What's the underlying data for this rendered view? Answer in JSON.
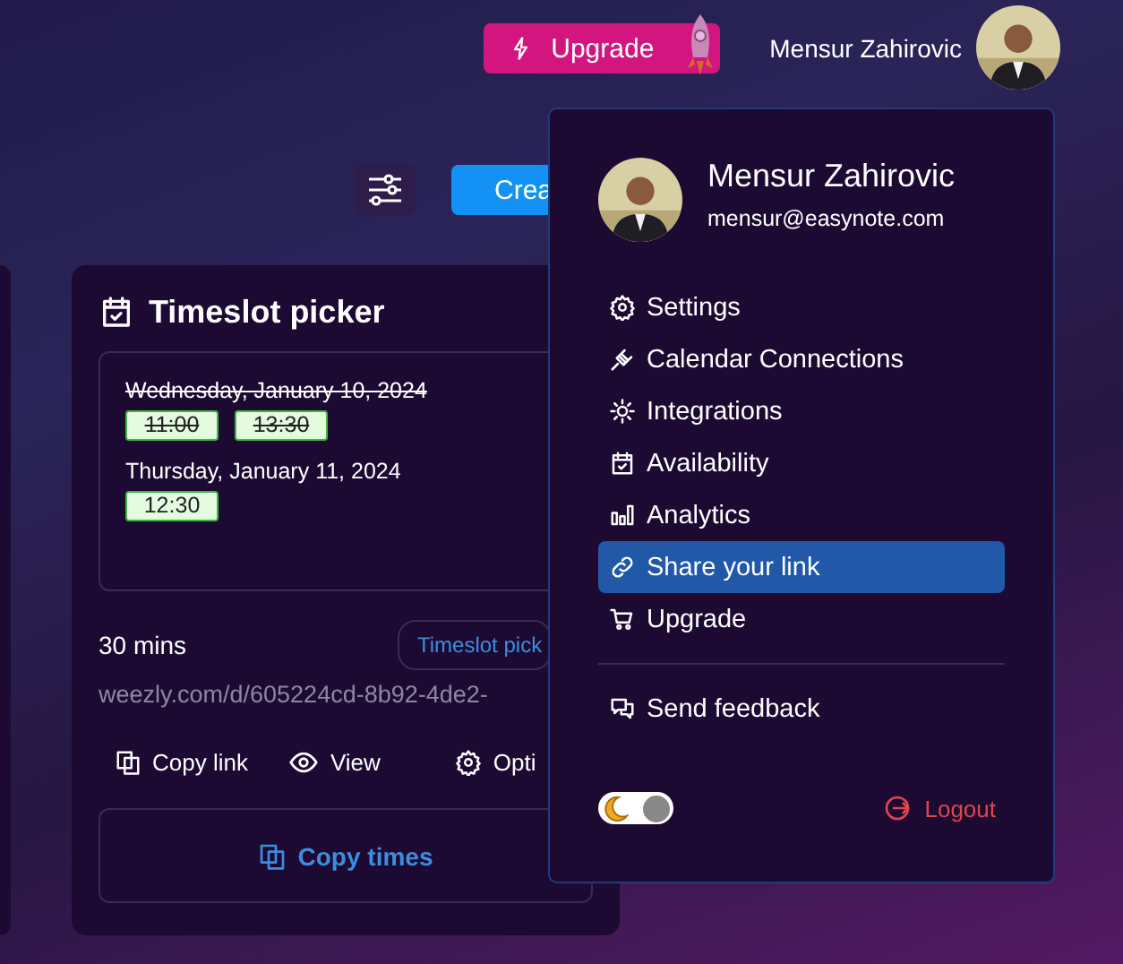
{
  "header": {
    "upgrade_button": "Upgrade",
    "user_name": "Mensur Zahirovic"
  },
  "toolbar": {
    "create_button": "Crea"
  },
  "card": {
    "title": "Timeslot picker",
    "days": [
      {
        "date": "Wednesday, January 10, 2024",
        "disabled": true,
        "slots": [
          {
            "time": "11:00",
            "disabled": true
          },
          {
            "time": "13:30",
            "disabled": true
          }
        ]
      },
      {
        "date": "Thursday, January 11, 2024",
        "disabled": false,
        "slots": [
          {
            "time": "12:30",
            "disabled": false
          }
        ]
      }
    ],
    "duration": "30 mins",
    "type_badge": "Timeslot pick",
    "link": "weezly.com/d/605224cd-8b92-4de2-",
    "actions": [
      "Copy link",
      "View",
      "Opti"
    ],
    "copy_times_button": "Copy times"
  },
  "user_menu": {
    "name": "Mensur Zahirovic",
    "email": "mensur@easynote.com",
    "items": [
      {
        "label": "Settings",
        "selected": false
      },
      {
        "label": "Calendar Connections",
        "selected": false
      },
      {
        "label": "Integrations",
        "selected": false
      },
      {
        "label": "Availability",
        "selected": false
      },
      {
        "label": "Analytics",
        "selected": false
      },
      {
        "label": "Share your link",
        "selected": true
      },
      {
        "label": "Upgrade",
        "selected": false
      }
    ],
    "feedback": "Send feedback",
    "dark_mode_toggle": {
      "on": true
    },
    "logout": "Logout"
  }
}
